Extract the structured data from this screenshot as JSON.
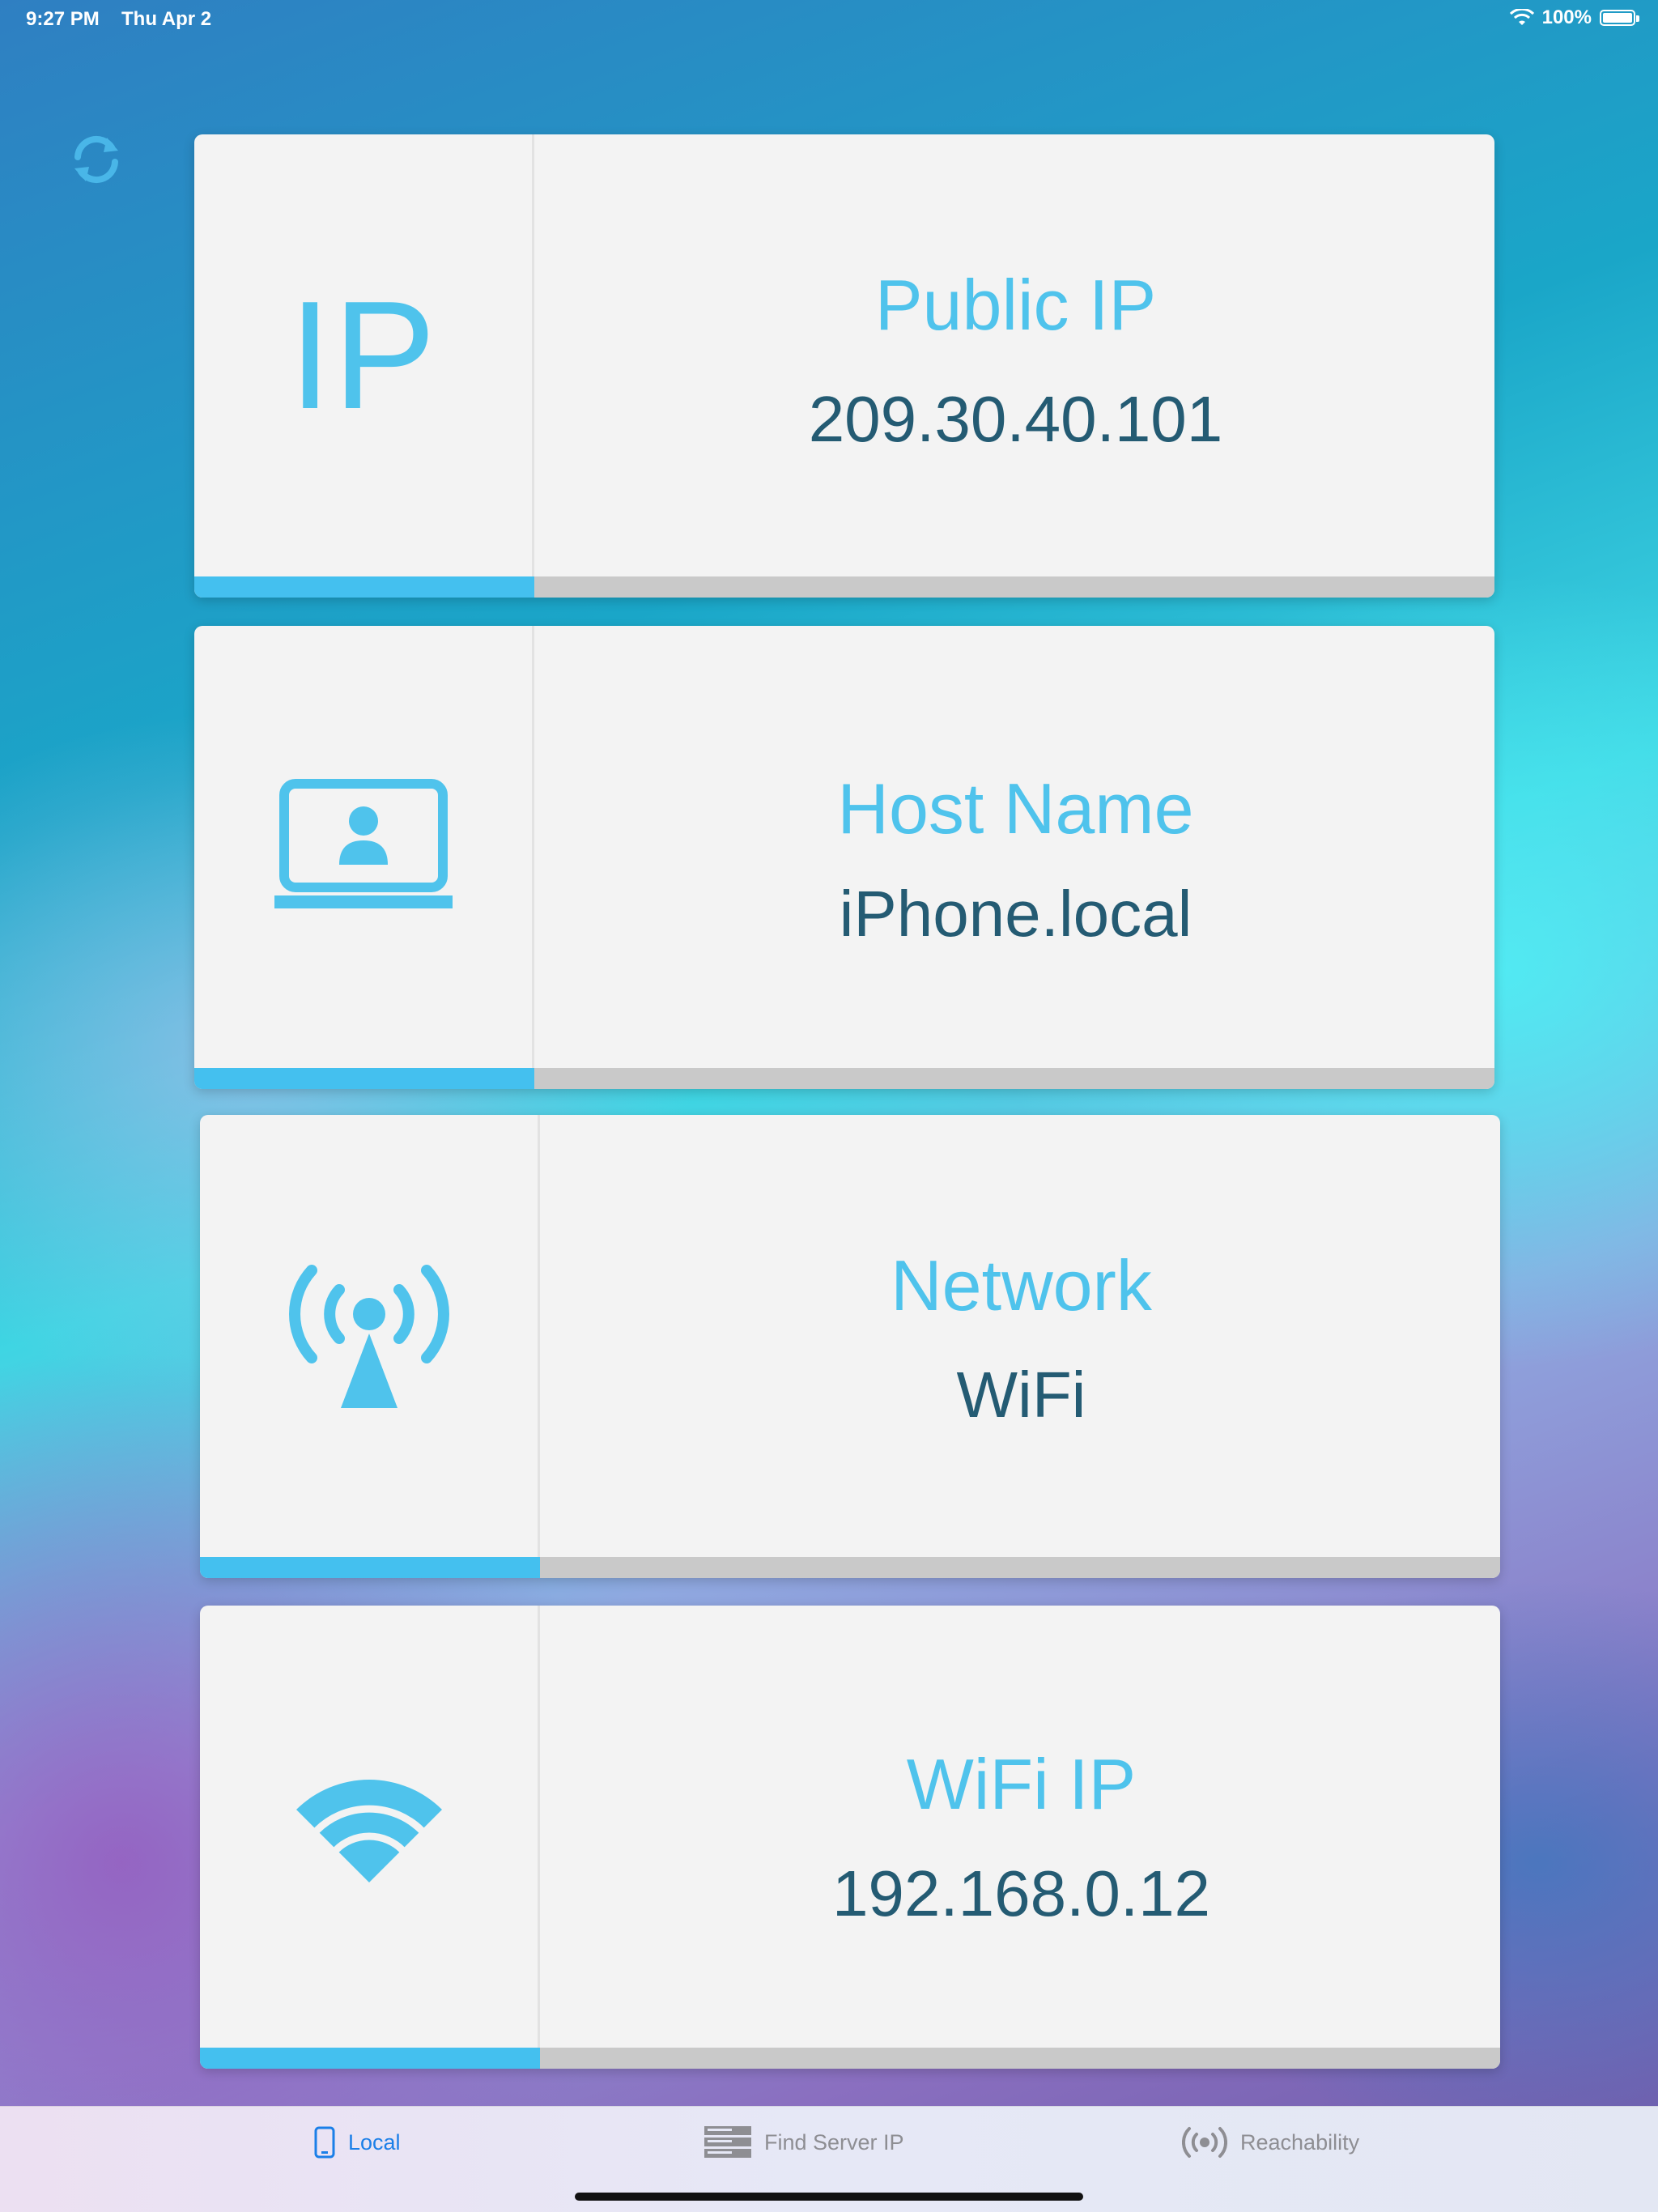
{
  "status": {
    "time": "9:27 PM",
    "date": "Thu Apr 2",
    "battery": "100%"
  },
  "cards": [
    {
      "title": "Public IP",
      "value": "209.30.40.101",
      "icon_text": "IP"
    },
    {
      "title": "Host Name",
      "value": "iPhone.local"
    },
    {
      "title": "Network",
      "value": "WiFi"
    },
    {
      "title": "WiFi IP",
      "value": "192.168.0.12"
    }
  ],
  "tabs": [
    {
      "label": "Local",
      "selected": true
    },
    {
      "label": "Find Server IP",
      "selected": false
    },
    {
      "label": "Reachability",
      "selected": false
    }
  ],
  "icons": [
    "refresh-icon",
    "laptop-user-icon",
    "antenna-broadcast-icon",
    "wifi-icon",
    "phone-icon",
    "server-icon",
    "reachability-icon"
  ],
  "colors": {
    "accent": "#4fc3ec",
    "value_text": "#245b73",
    "tab_active": "#1b7fe8",
    "tab_inactive": "#8e8e93"
  }
}
